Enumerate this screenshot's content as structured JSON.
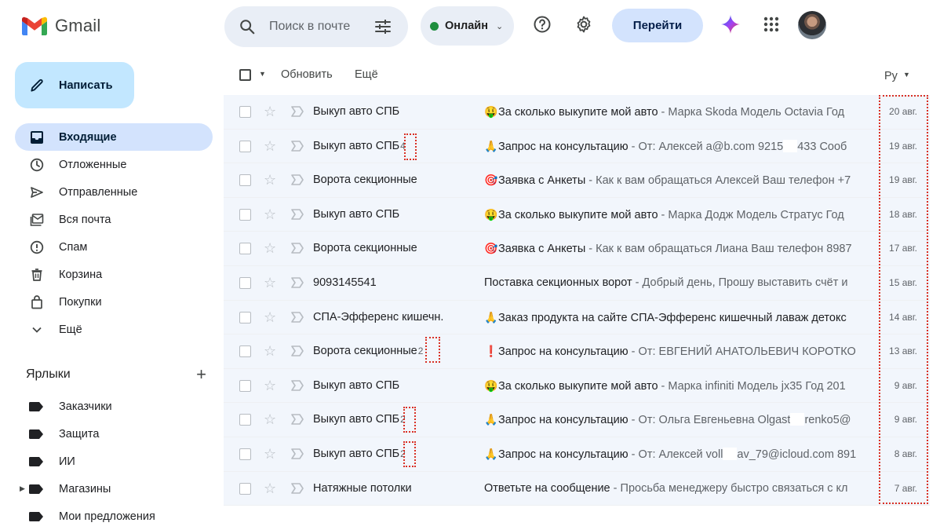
{
  "app": {
    "name": "Gmail",
    "colors": {
      "accent": "#0b57d0",
      "compose_bg": "#c2e7ff",
      "active_nav": "#d3e3fd",
      "online": "#1e8e3e",
      "annotation": "#d93025"
    }
  },
  "header": {
    "search_placeholder": "Поиск в почте",
    "status_label": "Онлайн",
    "goto_label": "Перейти",
    "icons": [
      "search-icon",
      "tune-icon",
      "help-icon",
      "gear-icon",
      "gemini-icon",
      "apps-grid-icon"
    ]
  },
  "sidebar": {
    "compose_label": "Написать",
    "items": [
      {
        "label": "Входящие",
        "icon": "inbox-icon",
        "active": true
      },
      {
        "label": "Отложенные",
        "icon": "clock-icon"
      },
      {
        "label": "Отправленные",
        "icon": "send-icon"
      },
      {
        "label": "Вся почта",
        "icon": "all-mail-icon"
      },
      {
        "label": "Спам",
        "icon": "spam-icon"
      },
      {
        "label": "Корзина",
        "icon": "trash-icon"
      },
      {
        "label": "Покупки",
        "icon": "bag-icon"
      },
      {
        "label": "Ещё",
        "icon": "chevron-down-icon"
      }
    ],
    "labels_title": "Ярлыки",
    "labels": [
      {
        "label": "Заказчики"
      },
      {
        "label": "Защита"
      },
      {
        "label": "ИИ"
      },
      {
        "label": "Магазины",
        "expandable": true
      },
      {
        "label": "Мои предложения"
      }
    ]
  },
  "toolbar": {
    "refresh_label": "Обновить",
    "more_label": "Ещё",
    "sort_label": "Ру"
  },
  "emails": [
    {
      "sender": "Выкуп авто СПБ",
      "count": "",
      "emoji": "🤑",
      "subject": "За сколько выкупите мой авто",
      "snippet": " - Марка Skoda Модель Octavia Год",
      "date": "20 авг."
    },
    {
      "sender": "Выкуп авто СПБ",
      "count": "4",
      "emoji": "🙏",
      "subject": "Запрос на консультацию",
      "snippet": " - От: Алексей a@b.com 9215",
      "snippet2": "433 Сооб",
      "date": "19 авг."
    },
    {
      "sender": "Ворота секционные",
      "count": "",
      "emoji": "🎯",
      "subject": "Заявка с Анкеты",
      "snippet": " - Как к вам обращаться Алексей Ваш телефон +7",
      "date": "19 авг."
    },
    {
      "sender": "Выкуп авто СПБ",
      "count": "",
      "emoji": "🤑",
      "subject": "За сколько выкупите мой авто",
      "snippet": " - Марка Додж Модель Стратус Год",
      "date": "18 авг."
    },
    {
      "sender": "Ворота секционные",
      "count": "",
      "emoji": "🎯",
      "subject": "Заявка с Анкеты",
      "snippet": " - Как к вам обращаться Лиана Ваш телефон 8987",
      "date": "17 авг."
    },
    {
      "sender": "9093145541",
      "count": "",
      "emoji": "",
      "subject": "Поставка секционных ворот",
      "snippet": " - Добрый день, Прошу выставить счёт и",
      "date": "15 авг."
    },
    {
      "sender": "СПА-Эфференс кишечн.",
      "count": "",
      "emoji": "🙏",
      "subject": "Заказ продукта на сайте СПА-Эфференс кишечный лаваж детокс",
      "snippet": "",
      "date": "14 авг."
    },
    {
      "sender": "Ворота секционные",
      "count": "2",
      "emoji": "❗",
      "subject": "Запрос на консультацию",
      "snippet": " - От: ЕВГЕНИЙ АНАТОЛЬЕВИЧ КОРОТКО",
      "date": "13 авг."
    },
    {
      "sender": "Выкуп авто СПБ",
      "count": "",
      "emoji": "🤑",
      "subject": "За сколько выкупите мой авто",
      "snippet": " - Марка infiniti Модель jx35 Год 201",
      "date": "9 авг."
    },
    {
      "sender": "Выкуп авто СПБ",
      "count": "2",
      "emoji": "🙏",
      "subject": "Запрос на консультацию",
      "snippet": " - От: Ольга Евгеньевна Olgast",
      "snippet2": "renko5@",
      "date": "9 авг."
    },
    {
      "sender": "Выкуп авто СПБ",
      "count": "2",
      "emoji": "🙏",
      "subject": "Запрос на консультацию",
      "snippet": " - От: Алексей voll",
      "snippet2": "av_79@icloud.com 891",
      "date": "8 авг."
    },
    {
      "sender": "Натяжные потолки",
      "count": "",
      "emoji": "",
      "subject": "Ответьте на сообщение",
      "snippet": " - Просьба менеджеру быстро связаться с кл",
      "date": "7 авг."
    }
  ]
}
